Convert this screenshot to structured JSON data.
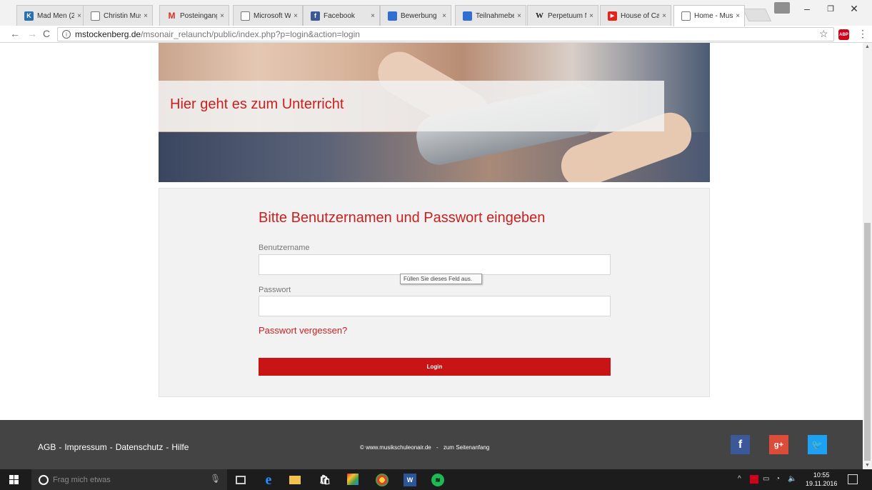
{
  "browser": {
    "tabs": [
      {
        "title": "Mad Men (2",
        "favicon": "k-icon",
        "color": "#2a6fb0",
        "glyph": "K"
      },
      {
        "title": "Christin Mus",
        "favicon": "page-icon",
        "color": "",
        "glyph": ""
      },
      {
        "title": "Posteingang",
        "favicon": "gmail-icon",
        "color": "#d93025",
        "glyph": "M"
      },
      {
        "title": "Microsoft W",
        "favicon": "page-icon",
        "color": "",
        "glyph": ""
      },
      {
        "title": "Facebook",
        "favicon": "facebook-icon",
        "color": "#3b5998",
        "glyph": "f"
      },
      {
        "title": "Bewerbung",
        "favicon": "folder-icon",
        "color": "#2f6fd1",
        "glyph": ""
      },
      {
        "title": "Teilnahmebe",
        "favicon": "folder-icon",
        "color": "#2f6fd1",
        "glyph": ""
      },
      {
        "title": "Perpetuum M",
        "favicon": "wikipedia-icon",
        "color": "",
        "glyph": "W"
      },
      {
        "title": "House of Ca",
        "favicon": "youtube-icon",
        "color": "#e62117",
        "glyph": "▶"
      },
      {
        "title": "Home - Mus",
        "favicon": "page-icon",
        "color": "",
        "glyph": ""
      }
    ],
    "active_tab": 9,
    "close_glyph": "×",
    "url_domain": "mstockenberg.de",
    "url_path": "/msonair_relaunch/public/index.php?p=login&action=login",
    "abp_label": "ABP"
  },
  "hero": {
    "title": "Hier geht es zum Unterricht"
  },
  "login": {
    "heading": "Bitte Benutzernamen und Passwort eingeben",
    "username_label": "Benutzername",
    "username_value": "",
    "password_label": "Passwort",
    "password_value": "",
    "tooltip": "Füllen Sie dieses Feld aus.",
    "forgot_link": "Passwort vergessen?",
    "button_label": "Login"
  },
  "footer": {
    "links": [
      "AGB",
      "Impressum",
      "Datenschutz",
      "Hilfe"
    ],
    "separator": "-",
    "copyright": "© www.musikschuleonair.de",
    "center_sep": "-",
    "to_top": "zum Seitenanfang",
    "social": [
      {
        "name": "facebook",
        "glyph": "f",
        "color": "#3b5998"
      },
      {
        "name": "google-plus",
        "glyph": "g+",
        "color": "#dd4b39"
      },
      {
        "name": "twitter",
        "glyph": "🐦",
        "color": "#1da1f2"
      }
    ]
  },
  "taskbar": {
    "search_placeholder": "Frag mich etwas",
    "time": "10:55",
    "date": "19.11.2016"
  }
}
